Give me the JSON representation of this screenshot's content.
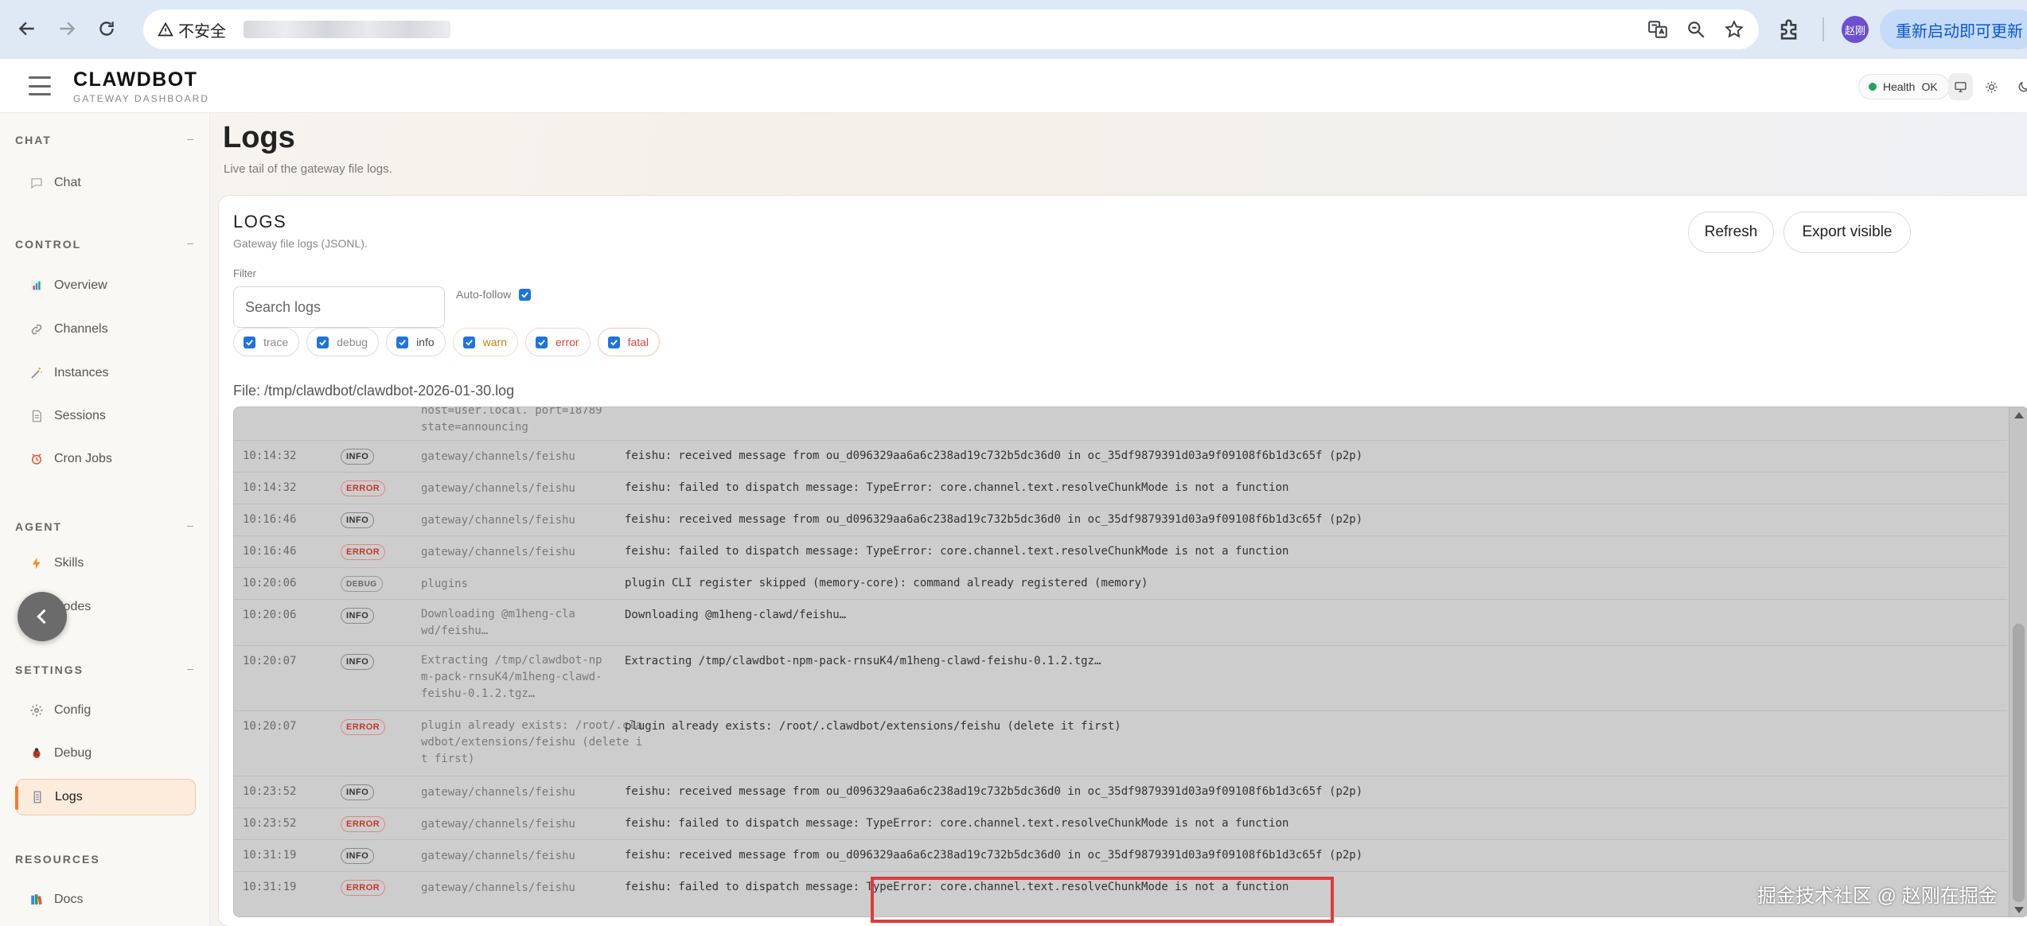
{
  "browser": {
    "insecure_label": "不安全",
    "update_label": "重新启动即可更新",
    "profile_initials": "赵刚"
  },
  "header": {
    "brand_name": "CLAWDBOT",
    "brand_sub": "GATEWAY DASHBOARD",
    "health_label": "Health",
    "health_status": "OK"
  },
  "sidebar": {
    "sections": [
      {
        "title": "CHAT",
        "items": [
          {
            "label": "Chat",
            "icon": "chat-bubble-icon"
          }
        ]
      },
      {
        "title": "CONTROL",
        "items": [
          {
            "label": "Overview",
            "icon": "bar-chart-icon"
          },
          {
            "label": "Channels",
            "icon": "link-icon"
          },
          {
            "label": "Instances",
            "icon": "wand-icon"
          },
          {
            "label": "Sessions",
            "icon": "document-icon"
          },
          {
            "label": "Cron Jobs",
            "icon": "clock-icon"
          }
        ]
      },
      {
        "title": "AGENT",
        "items": [
          {
            "label": "Skills",
            "icon": "lightning-icon"
          },
          {
            "label": "Nodes",
            "icon": "monitor-icon"
          }
        ]
      },
      {
        "title": "SETTINGS",
        "items": [
          {
            "label": "Config",
            "icon": "gear-icon"
          },
          {
            "label": "Debug",
            "icon": "bug-icon"
          },
          {
            "label": "Logs",
            "icon": "scroll-icon",
            "active": true
          }
        ]
      },
      {
        "title": "RESOURCES",
        "items": [
          {
            "label": "Docs",
            "icon": "books-icon"
          }
        ]
      }
    ]
  },
  "page": {
    "title": "Logs",
    "subtitle": "Live tail of the gateway file logs."
  },
  "card": {
    "title": "LOGS",
    "subtitle": "Gateway file logs (JSONL).",
    "refresh_label": "Refresh",
    "export_label": "Export visible",
    "filter_label": "Filter",
    "search_placeholder": "Search logs",
    "autofollow_label": "Auto-follow",
    "autofollow_checked": true,
    "levels": [
      {
        "label": "trace",
        "checked": true
      },
      {
        "label": "debug",
        "checked": true
      },
      {
        "label": "info",
        "checked": true
      },
      {
        "label": "warn",
        "checked": true
      },
      {
        "label": "error",
        "checked": true
      },
      {
        "label": "fatal",
        "checked": true
      }
    ],
    "file_path": "File: /tmp/clawdbot/clawdbot-2026-01-30.log"
  },
  "logs": {
    "partial_first_row": {
      "source_lines": [
        "host=user.local. port=18789",
        "state=announcing"
      ]
    },
    "rows": [
      {
        "time": "10:14:32",
        "level": "INFO",
        "source": "gateway/channels/feishu",
        "message": "feishu: received message from ou_d096329aa6a6c238ad19c732b5dc36d0 in oc_35df9879391d03a9f09108f6b1d3c65f (p2p)"
      },
      {
        "time": "10:14:32",
        "level": "ERROR",
        "source": "gateway/channels/feishu",
        "message": "feishu: failed to dispatch message: TypeError: core.channel.text.resolveChunkMode is not a function"
      },
      {
        "time": "10:16:46",
        "level": "INFO",
        "source": "gateway/channels/feishu",
        "message": "feishu: received message from ou_d096329aa6a6c238ad19c732b5dc36d0 in oc_35df9879391d03a9f09108f6b1d3c65f (p2p)"
      },
      {
        "time": "10:16:46",
        "level": "ERROR",
        "source": "gateway/channels/feishu",
        "message": "feishu: failed to dispatch message: TypeError: core.channel.text.resolveChunkMode is not a function"
      },
      {
        "time": "10:20:06",
        "level": "DEBUG",
        "source": "plugins",
        "message": "plugin CLI register skipped (memory-core): command already registered (memory)"
      },
      {
        "time": "10:20:06",
        "level": "INFO",
        "source": "Downloading @m1heng-clawd/feishu…",
        "message": "Downloading @m1heng-clawd/feishu…"
      },
      {
        "time": "10:20:07",
        "level": "INFO",
        "source": "Extracting /tmp/clawdbot-npm-pack-rnsuK4/m1heng-clawd-feishu-0.1.2.tgz…",
        "message": "Extracting /tmp/clawdbot-npm-pack-rnsuK4/m1heng-clawd-feishu-0.1.2.tgz…"
      },
      {
        "time": "10:20:07",
        "level": "ERROR",
        "source": "plugin already exists: /root/.clawdbot/extensions/feishu (delete it first)",
        "message": "plugin already exists: /root/.clawdbot/extensions/feishu (delete it first)"
      },
      {
        "time": "10:23:52",
        "level": "INFO",
        "source": "gateway/channels/feishu",
        "message": "feishu: received message from ou_d096329aa6a6c238ad19c732b5dc36d0 in oc_35df9879391d03a9f09108f6b1d3c65f (p2p)"
      },
      {
        "time": "10:23:52",
        "level": "ERROR",
        "source": "gateway/channels/feishu",
        "message": "feishu: failed to dispatch message: TypeError: core.channel.text.resolveChunkMode is not a function"
      },
      {
        "time": "10:31:19",
        "level": "INFO",
        "source": "gateway/channels/feishu",
        "message": "feishu: received message from ou_d096329aa6a6c238ad19c732b5dc36d0 in oc_35df9879391d03a9f09108f6b1d3c65f (p2p)"
      },
      {
        "time": "10:31:19",
        "level": "ERROR",
        "source": "gateway/channels/feishu",
        "message": "feishu: failed to dispatch message: TypeError: core.channel.text.resolveChunkMode is not a function"
      }
    ]
  },
  "watermark": "掘金技术社区 @ 赵刚在掘金",
  "colors": {
    "accent": "#ef7d32",
    "health_ok": "#22a35a",
    "error": "#d9453c",
    "warn": "#c2820f",
    "checkbox": "#1f73e0",
    "annotation_box": "#e03b3b"
  }
}
